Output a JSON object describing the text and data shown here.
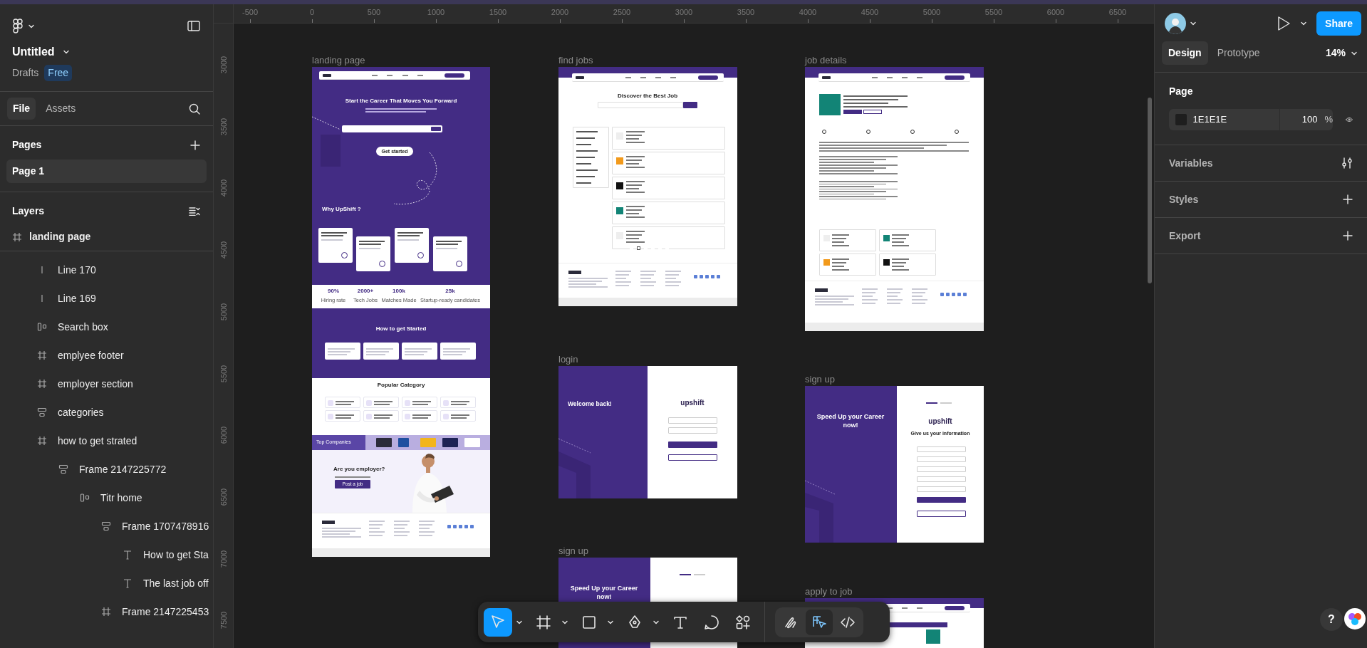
{
  "header": {
    "file_title": "Untitled",
    "location": "Drafts",
    "plan": "Free"
  },
  "left_tabs": [
    {
      "label": "File",
      "selected": true
    },
    {
      "label": "Assets",
      "selected": false
    }
  ],
  "pages": {
    "heading": "Pages",
    "items": [
      {
        "label": "Page 1",
        "selected": true
      }
    ]
  },
  "layers": {
    "heading": "Layers",
    "items": [
      {
        "name": "landing page",
        "kind": "frame",
        "children": [
          {
            "name": "Line 170",
            "kind": "line"
          },
          {
            "name": "Line 169",
            "kind": "line"
          },
          {
            "name": "Search box",
            "kind": "row"
          },
          {
            "name": "emplyee footer",
            "kind": "frame"
          },
          {
            "name": "employer section",
            "kind": "frame"
          },
          {
            "name": "categories",
            "kind": "column"
          },
          {
            "name": "how to get strated",
            "kind": "frame",
            "children": [
              {
                "name": "Frame 2147225772",
                "kind": "column",
                "children": [
                  {
                    "name": "Titr home",
                    "kind": "row",
                    "children": [
                      {
                        "name": "Frame 1707478916",
                        "kind": "column",
                        "children": [
                          {
                            "name": "How to get Sta",
                            "kind": "text"
                          },
                          {
                            "name": "The last job off",
                            "kind": "text"
                          }
                        ]
                      },
                      {
                        "name": "Frame 2147225453",
                        "kind": "frame"
                      }
                    ]
                  }
                ]
              }
            ]
          }
        ]
      }
    ]
  },
  "rulers": {
    "horizontal": [
      "-500",
      "0",
      "500",
      "1000",
      "1500",
      "2000",
      "2500",
      "3000",
      "3500",
      "4000",
      "4500",
      "5000",
      "5500",
      "6000",
      "6500"
    ],
    "vertical": [
      "3000",
      "3500",
      "4000",
      "4500",
      "5000",
      "5500",
      "6000",
      "6500",
      "7000",
      "7500"
    ]
  },
  "canvas": {
    "frames": [
      {
        "kind": "landing",
        "label": "landing page",
        "hero_title": "Start the Career That Moves You Forward",
        "hero_button": "Get started",
        "why_title": "Why UpShift ?",
        "stats": [
          {
            "value": "90%",
            "label": "Hiring rate"
          },
          {
            "value": "2000+",
            "label": "Tech Jobs"
          },
          {
            "value": "100k",
            "label": "Matches Made"
          },
          {
            "value": "25k",
            "label": "Startup-ready candidates"
          }
        ],
        "steps_title": "How to get Started",
        "categories_title": "Popular Category",
        "companies_label": "Top Companies",
        "employer_title": "Are you employer?",
        "employer_button": "Post a job"
      },
      {
        "kind": "find_jobs",
        "label": "find jobs",
        "title": "Discover the Best Job"
      },
      {
        "kind": "job_details",
        "label": "job details"
      },
      {
        "kind": "login",
        "label": "login",
        "welcome": "Welcome back!",
        "logo": "upshift"
      },
      {
        "kind": "signup",
        "label": "sign up",
        "slogan": "Speed Up your Career now!",
        "logo": "upshift",
        "form_title": "Give us your information"
      },
      {
        "kind": "signup",
        "label": "sign up",
        "slogan": "Speed Up your Career now!"
      },
      {
        "kind": "apply",
        "label": "apply to job"
      }
    ]
  },
  "toolbar": {
    "tools": [
      {
        "kind": "move",
        "selected": true,
        "menu": true
      },
      {
        "kind": "frame",
        "selected": false,
        "menu": true
      },
      {
        "kind": "rectangle",
        "selected": false,
        "menu": true
      },
      {
        "kind": "pen",
        "selected": false,
        "menu": true
      },
      {
        "kind": "text",
        "selected": false,
        "menu": false
      },
      {
        "kind": "comment",
        "selected": false,
        "menu": false
      },
      {
        "kind": "actions",
        "selected": false,
        "menu": false
      }
    ],
    "modes": [
      {
        "kind": "draw",
        "selected": false
      },
      {
        "kind": "design",
        "selected": true
      },
      {
        "kind": "dev",
        "selected": false
      }
    ]
  },
  "right_panel": {
    "tabs": [
      {
        "label": "Design",
        "selected": true
      },
      {
        "label": "Prototype",
        "selected": false
      }
    ],
    "share": "Share",
    "zoom": "14%",
    "page": {
      "heading": "Page",
      "color": "1E1E1E",
      "opacity": "100",
      "unit": "%"
    },
    "sections": [
      {
        "label": "Variables",
        "kind": "variables"
      },
      {
        "label": "Styles",
        "kind": "add"
      },
      {
        "label": "Export",
        "kind": "add"
      }
    ]
  },
  "help": "?"
}
